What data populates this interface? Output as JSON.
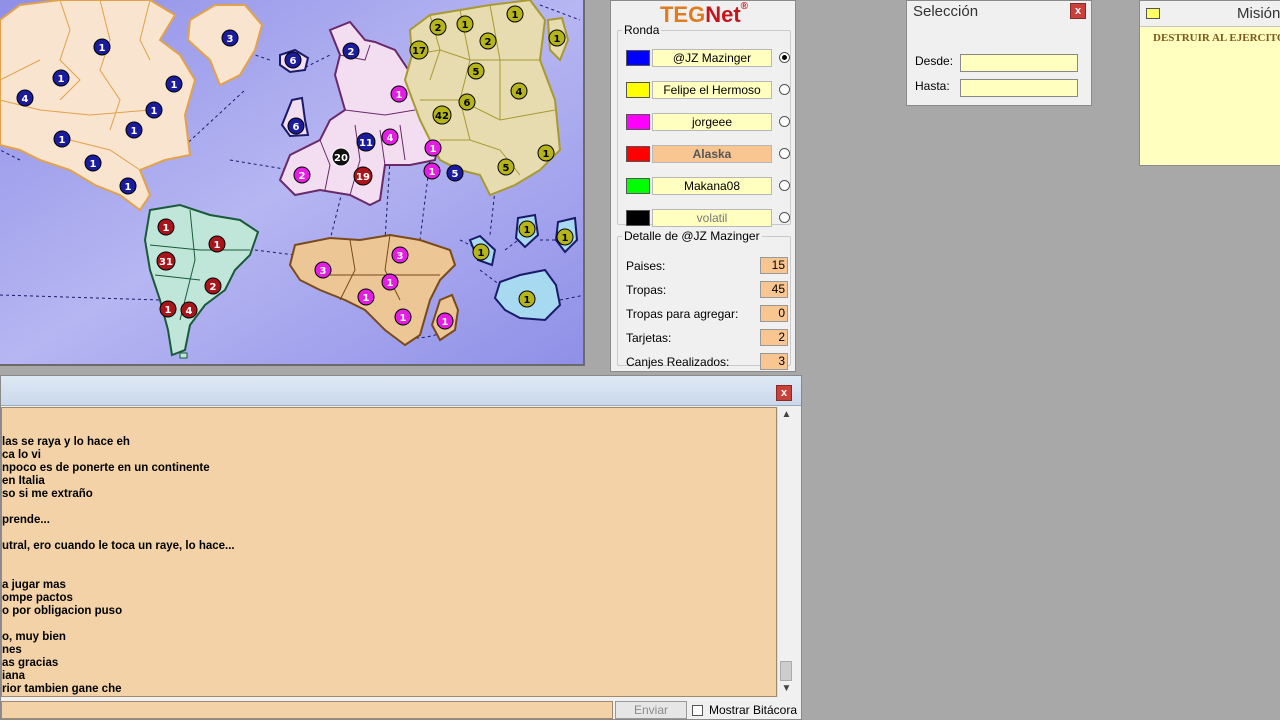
{
  "map": {
    "territories": [
      {
        "label": "3",
        "color": "blue"
      },
      {
        "label": "1",
        "color": "blue"
      },
      {
        "label": "1",
        "color": "blue"
      },
      {
        "label": "4",
        "color": "blue"
      },
      {
        "label": "1",
        "color": "blue"
      },
      {
        "label": "1",
        "color": "blue"
      },
      {
        "label": "1",
        "color": "blue"
      },
      {
        "label": "1",
        "color": "blue"
      },
      {
        "label": "1",
        "color": "blue"
      },
      {
        "label": "1",
        "color": "blue"
      },
      {
        "label": "6",
        "color": "blue"
      },
      {
        "label": "6",
        "color": "blue"
      },
      {
        "label": "2",
        "color": "blue"
      },
      {
        "label": "11",
        "color": "blue"
      },
      {
        "label": "5",
        "color": "blue"
      },
      {
        "label": "1",
        "color": "red"
      },
      {
        "label": "1",
        "color": "red"
      },
      {
        "label": "31",
        "color": "red"
      },
      {
        "label": "2",
        "color": "red"
      },
      {
        "label": "1",
        "color": "red"
      },
      {
        "label": "4",
        "color": "red"
      },
      {
        "label": "19",
        "color": "red"
      },
      {
        "label": "20",
        "color": "black"
      },
      {
        "label": "1",
        "color": "magenta"
      },
      {
        "label": "4",
        "color": "magenta"
      },
      {
        "label": "1",
        "color": "magenta"
      },
      {
        "label": "2",
        "color": "magenta"
      },
      {
        "label": "1",
        "color": "magenta"
      },
      {
        "label": "3",
        "color": "magenta"
      },
      {
        "label": "3",
        "color": "magenta"
      },
      {
        "label": "1",
        "color": "magenta"
      },
      {
        "label": "1",
        "color": "magenta"
      },
      {
        "label": "1",
        "color": "magenta"
      },
      {
        "label": "1",
        "color": "magenta"
      },
      {
        "label": "2",
        "color": "olive"
      },
      {
        "label": "1",
        "color": "olive"
      },
      {
        "label": "1",
        "color": "olive"
      },
      {
        "label": "17",
        "color": "olive"
      },
      {
        "label": "2",
        "color": "olive"
      },
      {
        "label": "1",
        "color": "olive"
      },
      {
        "label": "5",
        "color": "olive"
      },
      {
        "label": "4",
        "color": "olive"
      },
      {
        "label": "6",
        "color": "olive"
      },
      {
        "label": "42",
        "color": "olive"
      },
      {
        "label": "1",
        "color": "olive"
      },
      {
        "label": "5",
        "color": "olive"
      },
      {
        "label": "1",
        "color": "olive"
      },
      {
        "label": "1",
        "color": "olive"
      },
      {
        "label": "1",
        "color": "olive"
      },
      {
        "label": "1",
        "color": "olive"
      }
    ]
  },
  "colors": {
    "blue": "#1b1b9e",
    "red": "#a8161c",
    "magenta": "#e31de3",
    "olive": "#b5b51a",
    "black": "#111111",
    "sea": "#9e9eea",
    "north_america": "#f8e4cf",
    "south_america": "#bfe6d8",
    "europe": "#f3def1",
    "asia": "#e6dcb0",
    "africa": "#ecc795",
    "oceania": "#a7d9f0"
  },
  "panel": {
    "logo_teg": "TEG",
    "logo_net": "Net",
    "logo_reg": "®",
    "ronda_label": "Ronda",
    "players": [
      {
        "name": "@JZ Mazinger",
        "color": "#0000ff",
        "selected": true
      },
      {
        "name": "Felipe el Hermoso",
        "color": "#ffff00",
        "selected": false
      },
      {
        "name": "jorgeee",
        "color": "#ff00ff",
        "selected": false
      },
      {
        "name": "Alaska",
        "color": "#ff0000",
        "selected": false
      },
      {
        "name": "Makana08",
        "color": "#00ff00",
        "selected": false
      },
      {
        "name": "volatil",
        "color": "#000000",
        "selected": false
      }
    ],
    "detalle_label": "Detalle de @JZ Mazinger",
    "stats": [
      {
        "label": "Paises:",
        "value": "15"
      },
      {
        "label": "Tropas:",
        "value": "45"
      },
      {
        "label": "Tropas para agregar:",
        "value": "0"
      },
      {
        "label": "Tarjetas:",
        "value": "2"
      },
      {
        "label": "Canjes Realizados:",
        "value": "3"
      }
    ]
  },
  "seleccion": {
    "title": "Selección",
    "close": "x",
    "desde_label": "Desde:",
    "hasta_label": "Hasta:"
  },
  "mision": {
    "title": "Misión",
    "text": "DESTRUIR AL EJERCITO"
  },
  "chat": {
    "close": "x",
    "lines": [
      "las se raya y lo hace eh",
      "ca lo vi",
      "npoco es de ponerte en un continente",
      "en Italia",
      "so si me extraño",
      "",
      "prende...",
      "",
      "utral, ero cuando le toca un raye, lo hace...",
      "",
      "",
      "a jugar mas",
      "ompe pactos",
      "o por obligacion puso",
      "",
      "o, muy bien",
      "nes",
      "as gracias",
      "iana",
      "rior tambien gane che"
    ],
    "send_label": "Enviar",
    "bitacora_label": "Mostrar Bitácora"
  }
}
